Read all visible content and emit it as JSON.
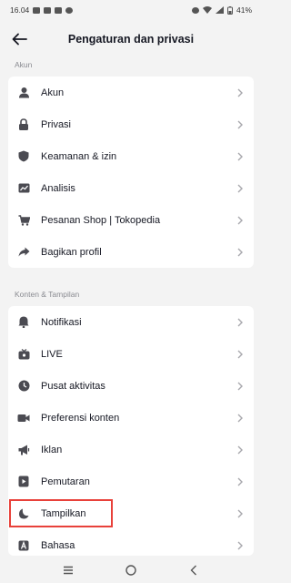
{
  "status": {
    "time": "16.04",
    "battery": "41%"
  },
  "header": {
    "title": "Pengaturan dan privasi"
  },
  "sections": [
    {
      "label": "Akun",
      "items": [
        {
          "label": "Akun",
          "icon": "person-icon"
        },
        {
          "label": "Privasi",
          "icon": "lock-icon"
        },
        {
          "label": "Keamanan & izin",
          "icon": "shield-icon"
        },
        {
          "label": "Analisis",
          "icon": "chart-icon"
        },
        {
          "label": "Pesanan Shop | Tokopedia",
          "icon": "cart-icon"
        },
        {
          "label": "Bagikan profil",
          "icon": "share-icon"
        }
      ]
    },
    {
      "label": "Konten & Tampilan",
      "items": [
        {
          "label": "Notifikasi",
          "icon": "bell-icon"
        },
        {
          "label": "LIVE",
          "icon": "live-icon"
        },
        {
          "label": "Pusat aktivitas",
          "icon": "clock-icon"
        },
        {
          "label": "Preferensi konten",
          "icon": "video-icon"
        },
        {
          "label": "Iklan",
          "icon": "megaphone-icon"
        },
        {
          "label": "Pemutaran",
          "icon": "play-icon"
        },
        {
          "label": "Tampilkan",
          "icon": "moon-icon"
        },
        {
          "label": "Bahasa",
          "icon": "language-icon"
        }
      ]
    }
  ],
  "colors": {
    "highlight": "#e8413a",
    "background": "#f3f3f3",
    "card": "#ffffff"
  }
}
